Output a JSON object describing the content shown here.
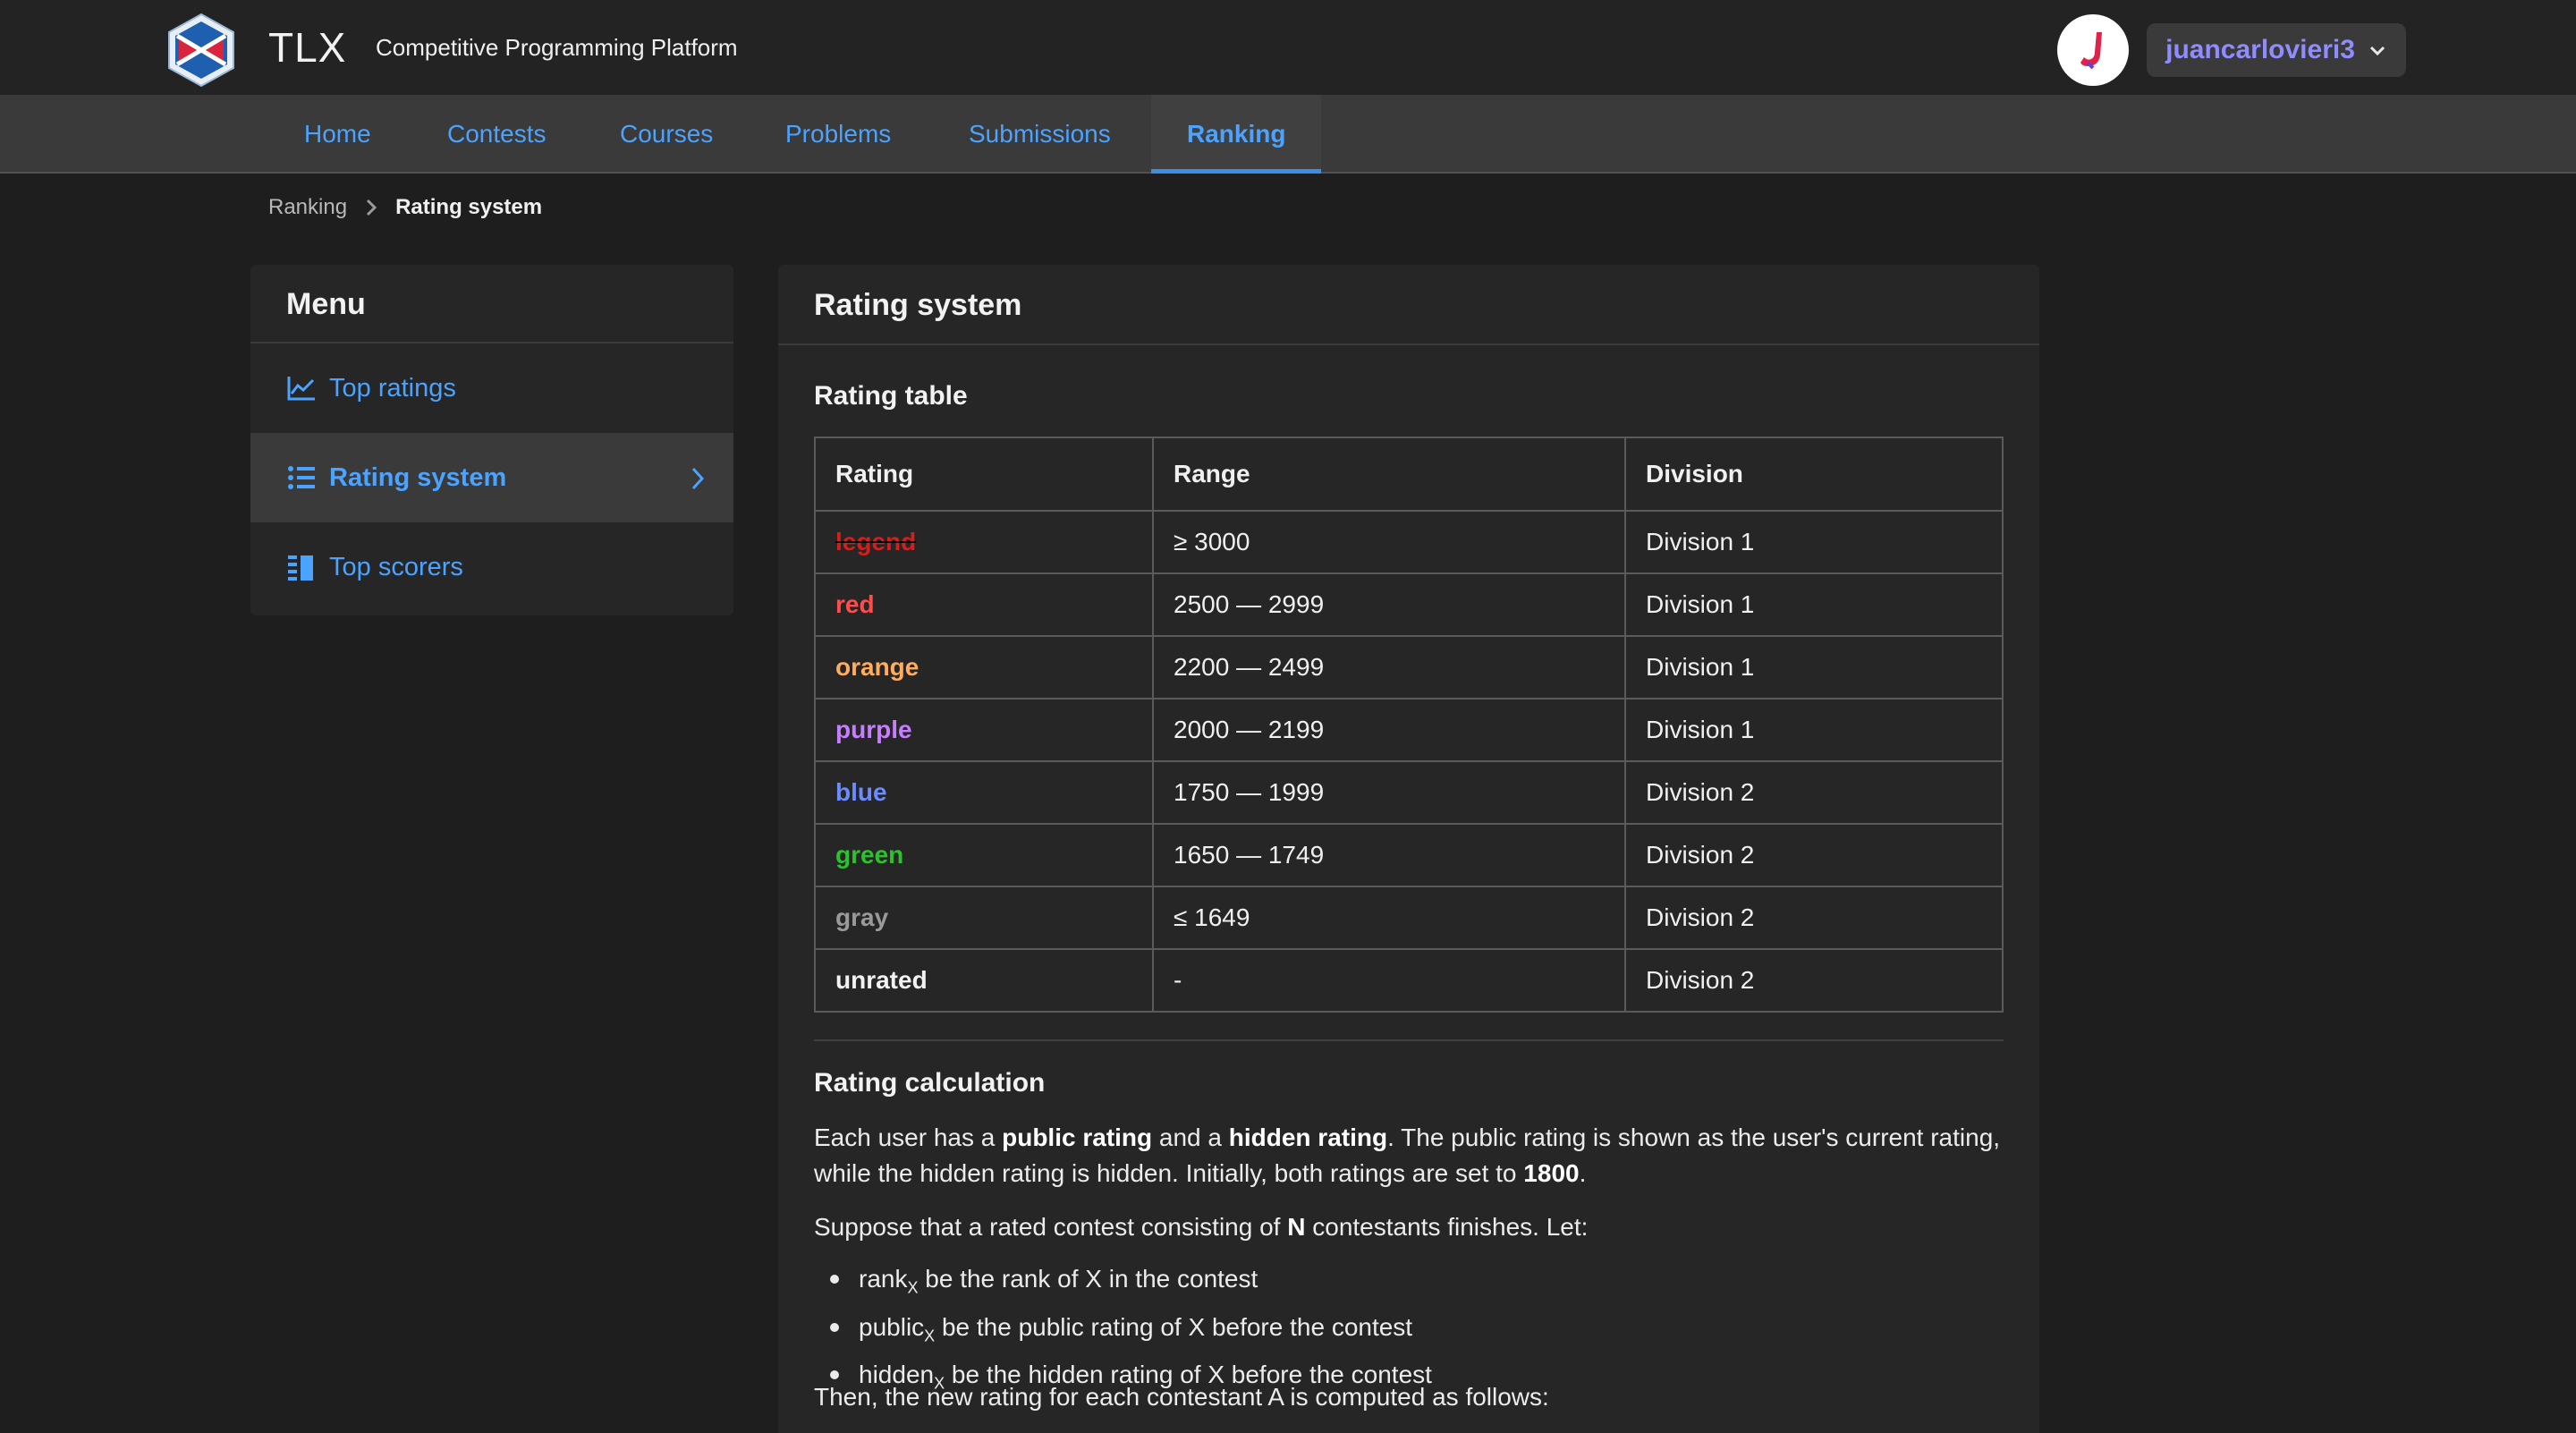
{
  "header": {
    "brand": "TLX",
    "tagline": "Competitive Programming Platform",
    "username": "juancarlovieri3"
  },
  "nav": {
    "items": [
      {
        "label": "Home"
      },
      {
        "label": "Contests"
      },
      {
        "label": "Courses"
      },
      {
        "label": "Problems"
      },
      {
        "label": "Submissions"
      },
      {
        "label": "Ranking"
      }
    ],
    "active": "Ranking"
  },
  "breadcrumb": {
    "root": "Ranking",
    "current": "Rating system"
  },
  "menu": {
    "title": "Menu",
    "items": [
      {
        "label": "Top ratings",
        "icon": "chart-line-icon"
      },
      {
        "label": "Rating system",
        "icon": "list-icon"
      },
      {
        "label": "Top scorers",
        "icon": "leaderboard-icon"
      }
    ]
  },
  "main": {
    "title": "Rating system",
    "table_title": "Rating table",
    "table": {
      "headers": [
        "Rating",
        "Range",
        "Division"
      ],
      "rows": [
        {
          "rating": "legend",
          "range": "≥ 3000",
          "division": "Division 1",
          "color": "#d21f1f"
        },
        {
          "rating": "red",
          "range": "2500 — 2999",
          "division": "Division 1",
          "color": "#ff4d4d"
        },
        {
          "rating": "orange",
          "range": "2200 — 2499",
          "division": "Division 1",
          "color": "#ffad5c"
        },
        {
          "rating": "purple",
          "range": "2000 — 2199",
          "division": "Division 1",
          "color": "#c77dff"
        },
        {
          "rating": "blue",
          "range": "1750 — 1999",
          "division": "Division 2",
          "color": "#6b8cff"
        },
        {
          "rating": "green",
          "range": "1650 — 1749",
          "division": "Division 2",
          "color": "#2bc22b"
        },
        {
          "rating": "gray",
          "range": "≤ 1649",
          "division": "Division 2",
          "color": "#9a9a9a"
        },
        {
          "rating": "unrated",
          "range": "-",
          "division": "Division 2",
          "color": "#f2f2f2"
        }
      ]
    },
    "calc_title": "Rating calculation",
    "calc_p1": {
      "t1": "Each user has a ",
      "b1": "public rating",
      "t2": " and a ",
      "b2": "hidden rating",
      "t3": ". The public rating is shown as the user's current rating, while the hidden rating is hidden. Initially, both ratings are set to ",
      "b3": "1800",
      "t4": "."
    },
    "calc_p2": {
      "t1": "Suppose that a rated contest consisting of ",
      "b1": "N",
      "t2": " contestants finishes. Let:"
    },
    "bullets": [
      {
        "term": "rank",
        "sub": "X",
        "text": " be the rank of X in the contest"
      },
      {
        "term": "public",
        "sub": "X",
        "text": " be the public rating of X before the contest"
      },
      {
        "term": "hidden",
        "sub": "X",
        "text": " be the hidden rating of X before the contest"
      }
    ],
    "calc_p3": "Then, the new rating for each contestant A is computed as follows:"
  },
  "colors": {
    "accent": "#4ba3ff",
    "username": "#8f8cff",
    "background": "#1e1e1e",
    "card": "#262626"
  }
}
